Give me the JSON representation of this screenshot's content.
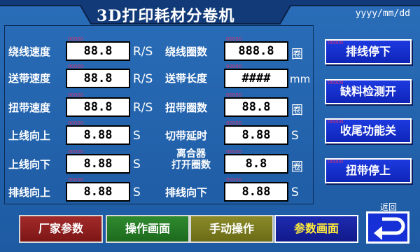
{
  "header": {
    "title": "3D打印耗材分卷机",
    "date": "yyyy/mm/dd"
  },
  "params": [
    {
      "label": "绕线速度",
      "value": "88.8",
      "unit": "R/S",
      "tag": "00000"
    },
    {
      "label": "送带速度",
      "value": "88.8",
      "unit": "R/S",
      "tag": "00000"
    },
    {
      "label": "扭带速度",
      "value": "88.8",
      "unit": "R/S",
      "tag": "00000"
    },
    {
      "label": "上线向上",
      "value": "8.88",
      "unit": "S",
      "tag": "00000"
    },
    {
      "label": "上线向下",
      "value": "8.88",
      "unit": "S",
      "tag": "00000"
    },
    {
      "label": "排线向上",
      "value": "8.88",
      "unit": "S",
      "tag": "00000"
    },
    {
      "label": "绕线圈数",
      "value": "888.8",
      "unit": "圈",
      "tag": "00000"
    },
    {
      "label": "送带长度",
      "value": "####",
      "unit": "mm",
      "tag": "00000"
    },
    {
      "label": "扭带圈数",
      "value": "88.8",
      "unit": "圈",
      "tag": "00000"
    },
    {
      "label": "切带延时",
      "value": "8.88",
      "unit": "S",
      "tag": "00000"
    },
    {
      "label_line1": "离合器",
      "label_line2": "打开圈数",
      "value": "8.8",
      "unit": "圈",
      "tag": "00000"
    },
    {
      "label": "排线向下",
      "value": "8.88",
      "unit": "S",
      "tag": "00000"
    }
  ],
  "side_buttons": [
    {
      "label": "排线停下",
      "tag": "00000"
    },
    {
      "label": "缺料检测开",
      "tag": "00000"
    },
    {
      "label": "收尾功能关",
      "tag": "00000"
    },
    {
      "label": "扭带停上",
      "tag": "00000"
    }
  ],
  "bottom_buttons": [
    {
      "label": "厂家参数"
    },
    {
      "label": "操作画面"
    },
    {
      "label": "手动操作"
    },
    {
      "label": "参数画面"
    }
  ],
  "back": {
    "label": "返回",
    "icon": "return-arrow-icon"
  }
}
